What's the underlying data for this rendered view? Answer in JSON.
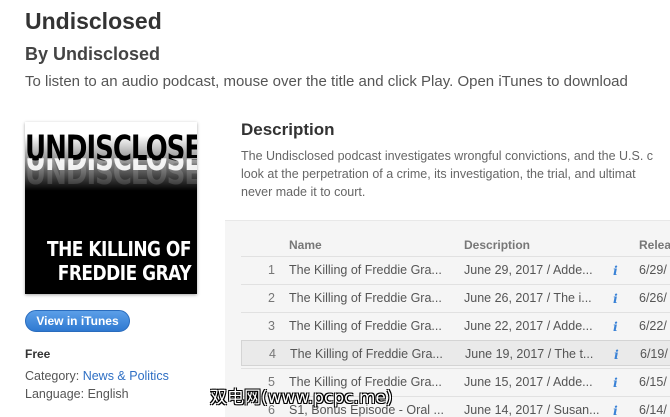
{
  "header": {
    "title": "Undisclosed",
    "byline": "By Undisclosed",
    "instructions": "To listen to an audio podcast, mouse over the title and click Play. Open iTunes to download"
  },
  "artwork": {
    "top_text": "UNDISCLOSED",
    "bottom_line1": "THE KILLING OF",
    "bottom_line2": "FREDDIE GRAY"
  },
  "sidebar": {
    "view_button": "View in iTunes",
    "price": "Free",
    "category_label": "Category:",
    "category_value": "News & Politics",
    "language_label": "Language:",
    "language_value": "English"
  },
  "description": {
    "heading": "Description",
    "lines": [
      "The Undisclosed podcast investigates wrongful convictions, and the U.S. c",
      "look at the perpetration of a crime, its investigation, the trial, and ultimat",
      "never made it to court."
    ]
  },
  "table": {
    "columns": {
      "name": "Name",
      "description": "Description",
      "released": "Relea"
    },
    "rows": [
      {
        "num": "1",
        "name": "The Killing of Freddie Gra...",
        "desc": "June 29, 2017 / Adde...",
        "info": "i",
        "released": "6/29/"
      },
      {
        "num": "2",
        "name": "The Killing of Freddie Gra...",
        "desc": "June 26, 2017 / The i...",
        "info": "i",
        "released": "6/26/"
      },
      {
        "num": "3",
        "name": "The Killing of Freddie Gra...",
        "desc": "June 22, 2017 / Adde...",
        "info": "i",
        "released": "6/22/"
      },
      {
        "num": "4",
        "name": "The Killing of Freddie Gra...",
        "desc": "June 19, 2017 / The t...",
        "info": "i",
        "released": "6/19/"
      },
      {
        "num": "5",
        "name": "The Killing of Freddie Gra...",
        "desc": "June 15, 2017 / Adde...",
        "info": "i",
        "released": "6/15/"
      },
      {
        "num": "6",
        "name": "S1, Bonus Episode - Oral ...",
        "desc": "June 14, 2017 / Susan...",
        "info": "i",
        "released": "6/14/"
      }
    ]
  },
  "watermark": "双电网(www.pcpc.me)"
}
